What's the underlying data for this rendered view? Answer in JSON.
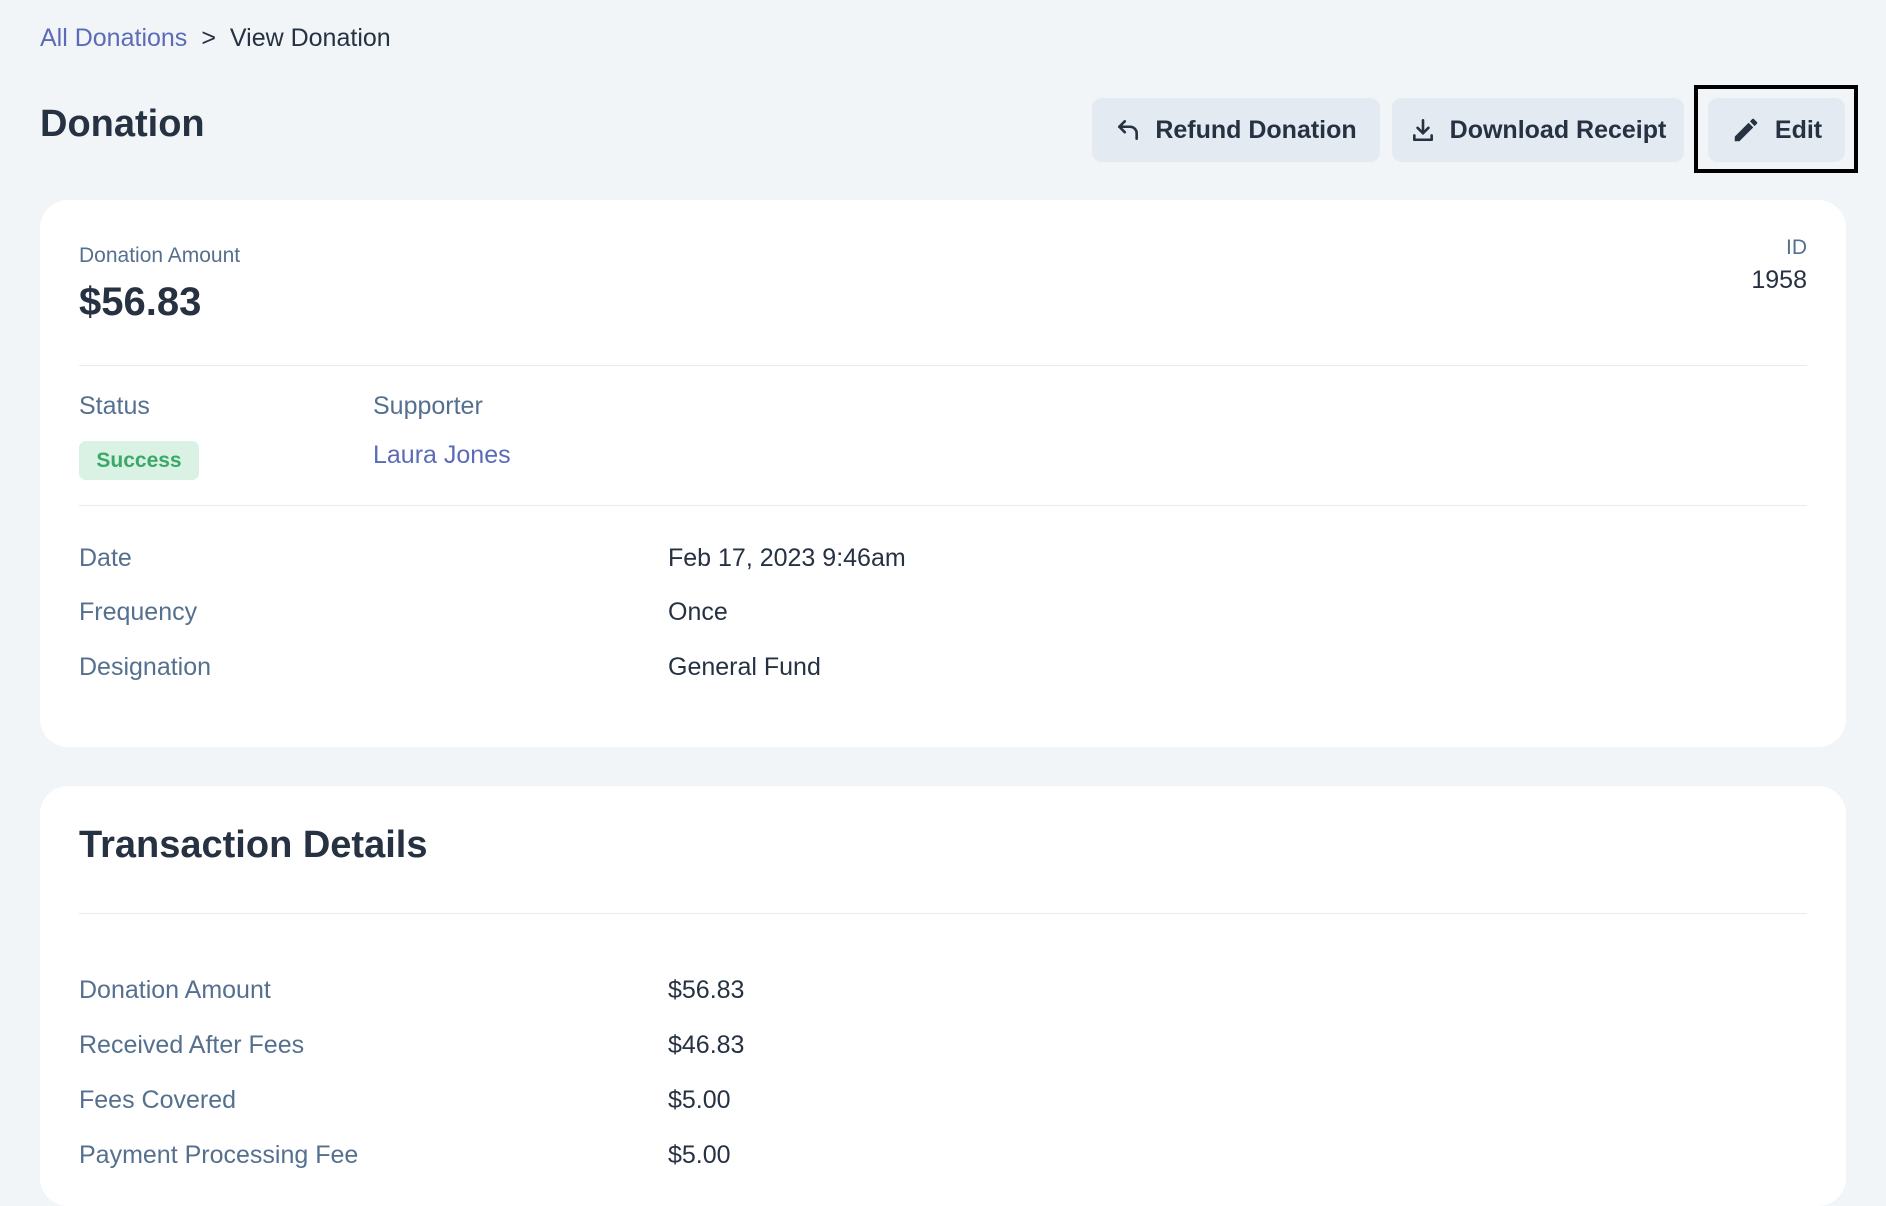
{
  "breadcrumb": {
    "parent": "All Donations",
    "separator": ">",
    "current": "View Donation"
  },
  "page": {
    "title": "Donation"
  },
  "actions": {
    "refund_label": "Refund Donation",
    "receipt_label": "Download Receipt",
    "edit_label": "Edit"
  },
  "summary": {
    "amount_label": "Donation Amount",
    "amount_value": "$56.83",
    "id_label": "ID",
    "id_value": "1958",
    "status_label": "Status",
    "status_value": "Success",
    "supporter_label": "Supporter",
    "supporter_name": "Laura Jones",
    "details": [
      {
        "label": "Date",
        "value": "Feb 17, 2023 9:46am"
      },
      {
        "label": "Frequency",
        "value": "Once"
      },
      {
        "label": "Designation",
        "value": "General Fund"
      }
    ]
  },
  "transaction": {
    "title": "Transaction Details",
    "rows": [
      {
        "label": "Donation Amount",
        "value": "$56.83"
      },
      {
        "label": "Received After Fees",
        "value": "$46.83"
      },
      {
        "label": "Fees Covered",
        "value": "$5.00"
      },
      {
        "label": "Payment Processing Fee",
        "value": "$5.00"
      }
    ]
  },
  "colors": {
    "background": "#f1f5f8",
    "link": "#5b6bb8",
    "success_bg": "#d9f2e3",
    "success_text": "#3aa867",
    "button_bg": "#e3eaf1"
  },
  "icons": {
    "refund": "undo-arrow-icon",
    "receipt": "download-icon",
    "edit": "pencil-icon"
  }
}
